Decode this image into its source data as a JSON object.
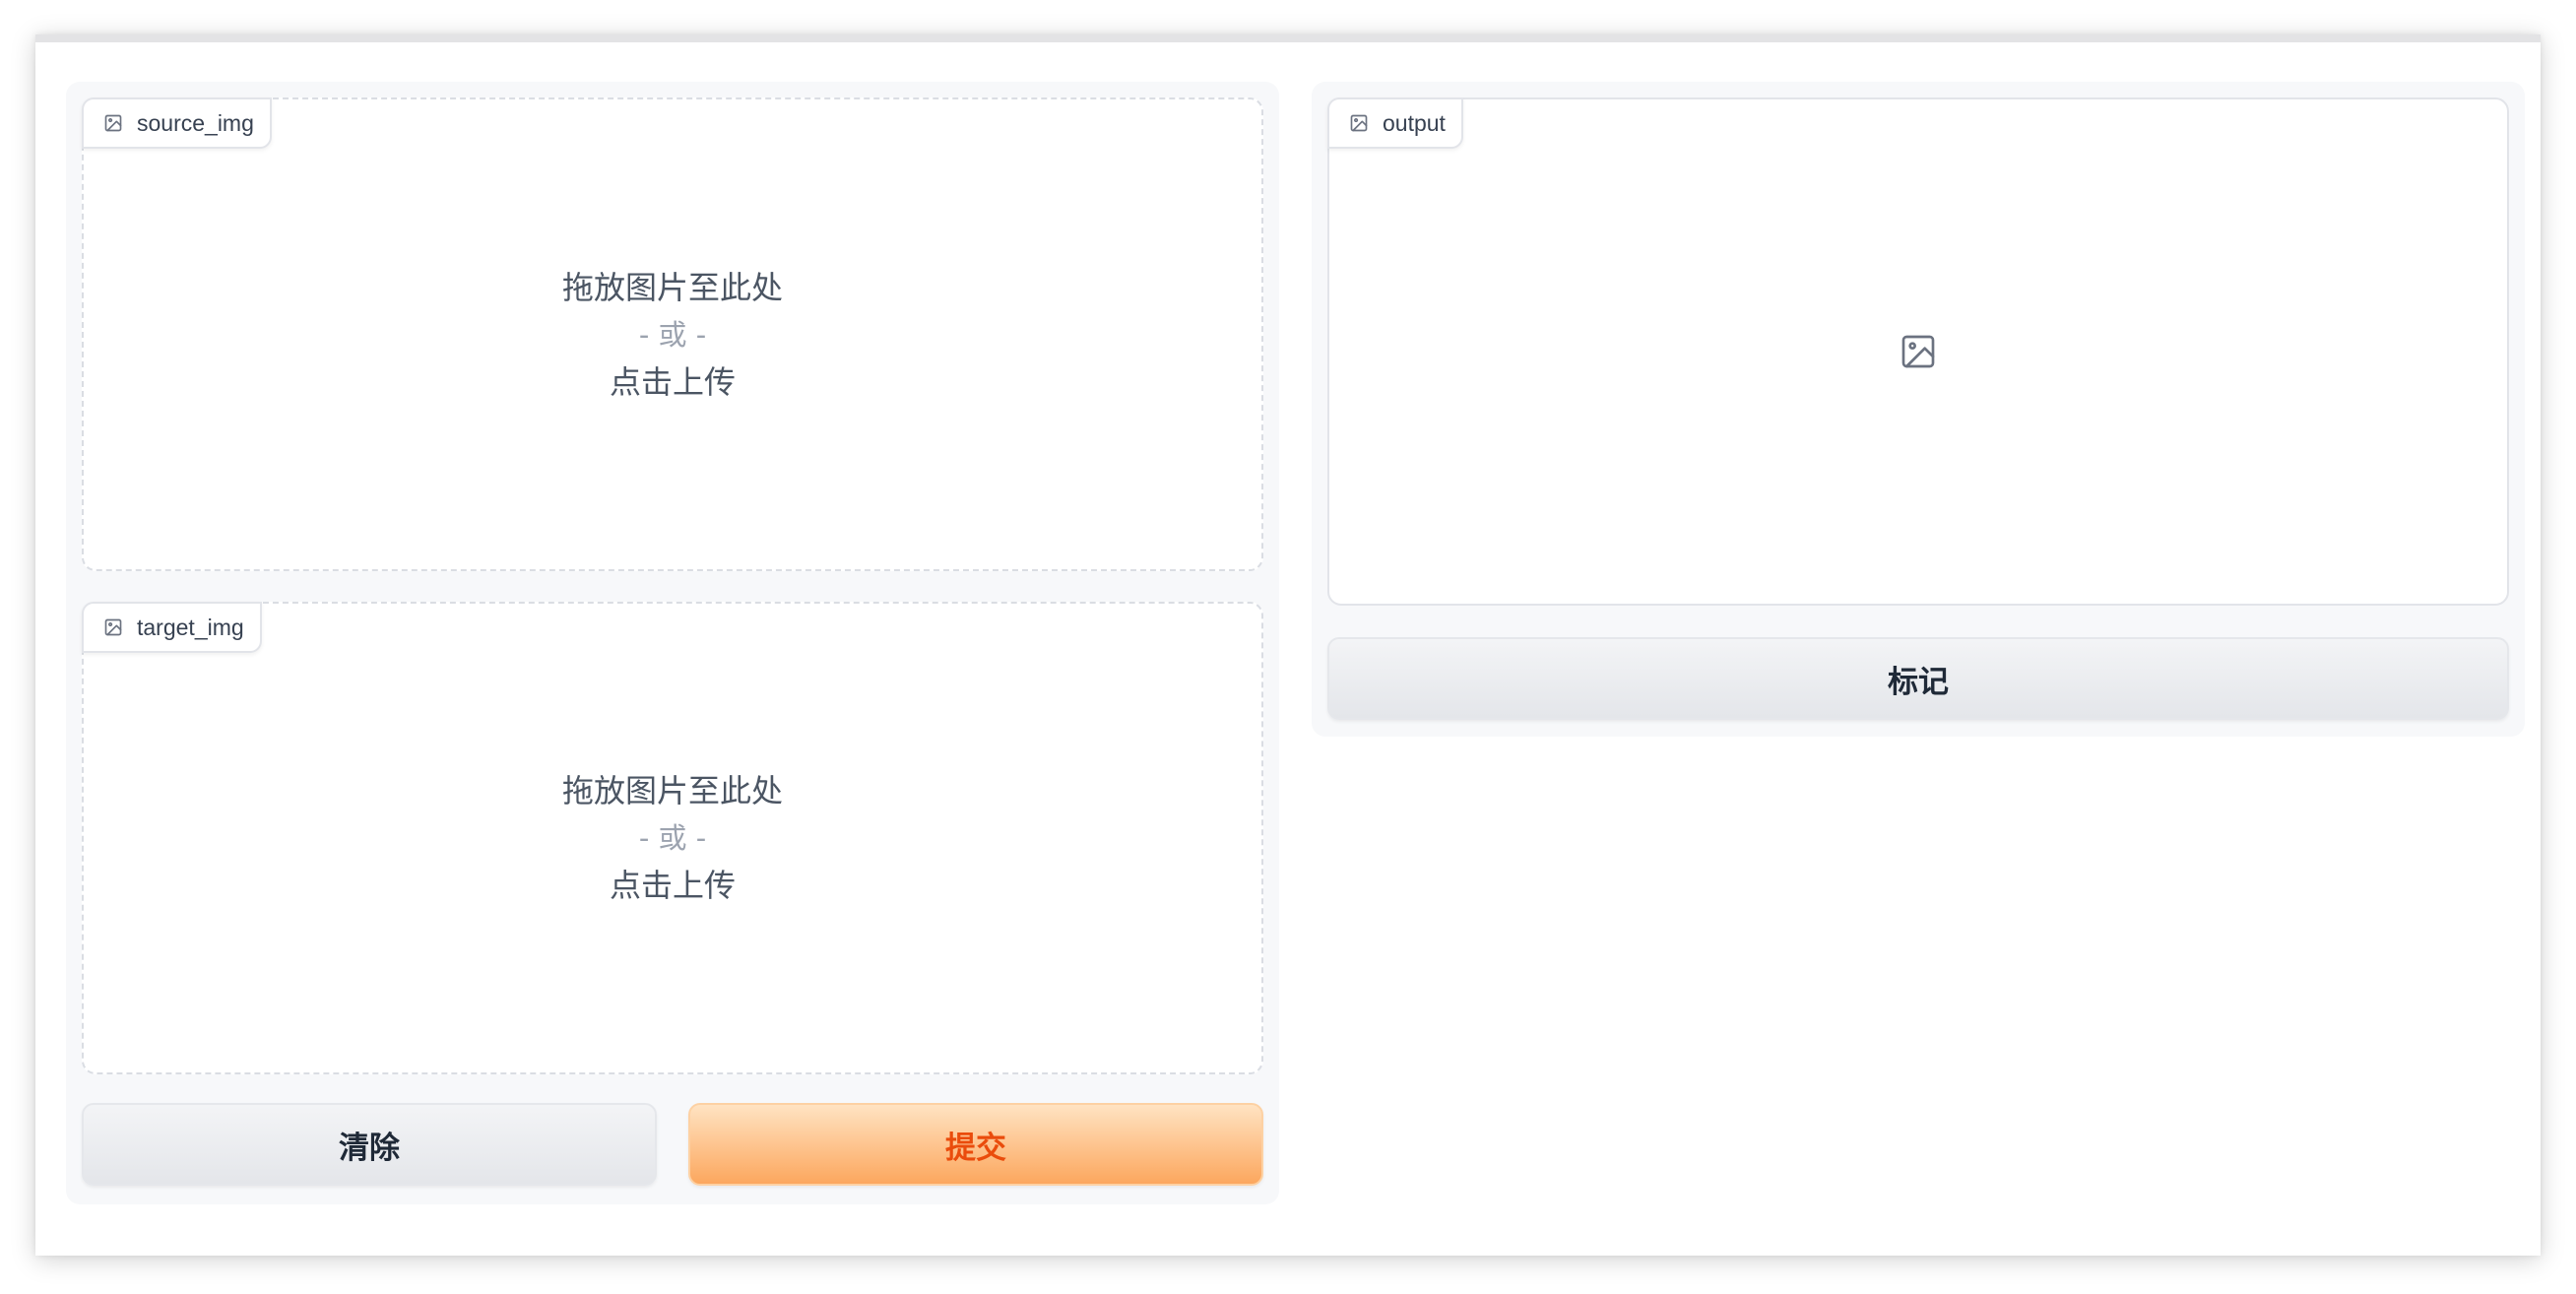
{
  "inputs": {
    "source": {
      "label": "source_img",
      "drop_text": "拖放图片至此处",
      "or_text": "- 或 -",
      "click_text": "点击上传"
    },
    "target": {
      "label": "target_img",
      "drop_text": "拖放图片至此处",
      "or_text": "- 或 -",
      "click_text": "点击上传"
    }
  },
  "output": {
    "label": "output"
  },
  "buttons": {
    "clear": "清除",
    "submit": "提交",
    "mark": "标记"
  },
  "colors": {
    "primary_text": "#ea4c0c",
    "primary_gradient_top": "#ffe3c2",
    "primary_gradient_bottom": "#fca75e"
  },
  "icons": {
    "label_icon": "image-icon",
    "output_placeholder_icon": "image-placeholder-icon"
  }
}
